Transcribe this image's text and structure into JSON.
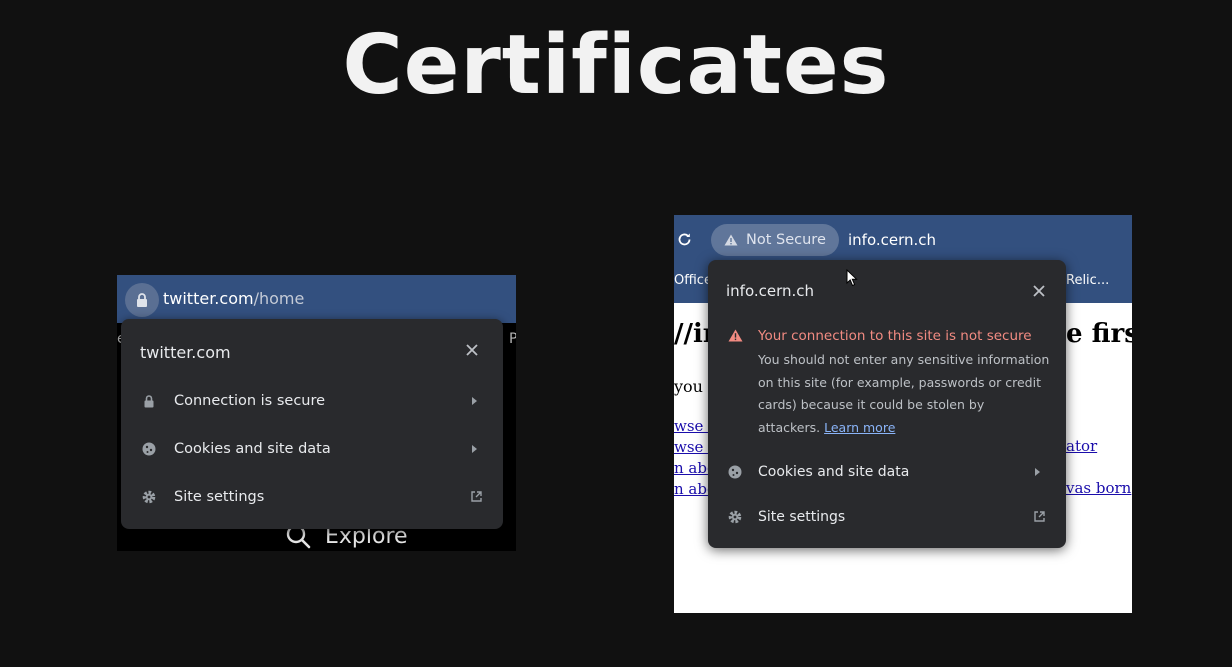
{
  "slide": {
    "title": "Certificates"
  },
  "left_screenshot": {
    "address_bar": {
      "host": "twitter.com",
      "path": "/home"
    },
    "edge_left": "e",
    "edge_right": "P",
    "popup": {
      "site": "twitter.com",
      "rows": [
        {
          "label": "Connection is secure",
          "icon": "lock-icon"
        },
        {
          "label": "Cookies and site data",
          "icon": "cookie-icon"
        },
        {
          "label": "Site settings",
          "icon": "gear-icon"
        }
      ]
    },
    "explore_label": "Explore"
  },
  "right_screenshot": {
    "address_bar": {
      "security_chip": "Not Secure",
      "url": "info.cern.ch"
    },
    "bookmarks": {
      "left": "Office",
      "right": "Relic..."
    },
    "popup": {
      "site": "info.cern.ch",
      "warning_title": "Your connection to this site is not secure",
      "warning_body": "You should not enter any sensitive information on this site (for example, passwords or credit cards) because it could be stolen by attackers.",
      "learn_more": "Learn more",
      "rows": [
        {
          "label": "Cookies and site data",
          "icon": "cookie-icon"
        },
        {
          "label": "Site settings",
          "icon": "gear-icon"
        }
      ]
    },
    "page_fragments": {
      "heading_left": "//ir",
      "heading_right": "e firs",
      "line_you": "you",
      "links": [
        "wse th",
        "wse th",
        "n abo",
        "n abo"
      ],
      "link_right_1": "ator",
      "link_right_2": "vas born"
    }
  },
  "colors": {
    "background": "#111111",
    "toolbar_blue": "#33507f",
    "popup_bg": "#292a2d",
    "warning_red": "#f28b82",
    "link_blue": "#8ab4f8"
  }
}
